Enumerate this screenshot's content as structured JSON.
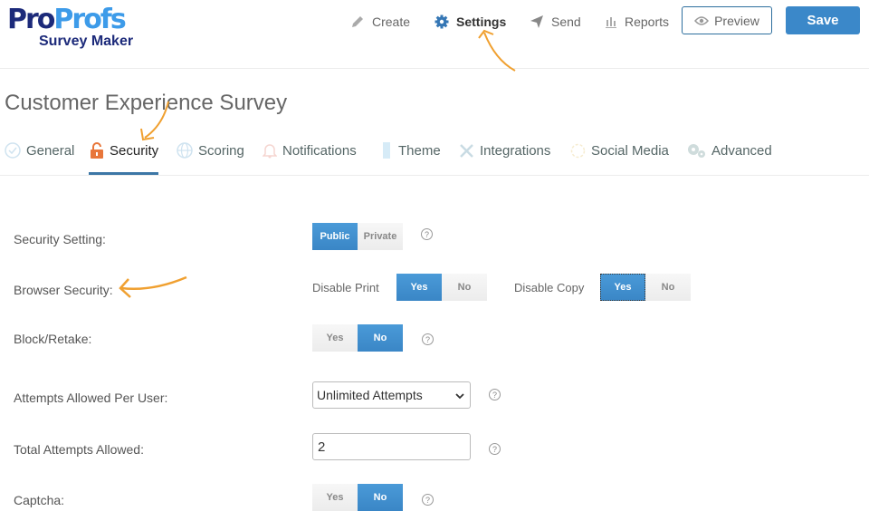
{
  "brand": {
    "logo_part1": "Pro",
    "logo_part2": "Profs",
    "logo_sub": "Survey Maker",
    "dark_color": "#1c2a7a",
    "light_color": "#3d9be9"
  },
  "topnav": {
    "items": [
      {
        "label": "Create",
        "icon": "pencil-icon",
        "active": false
      },
      {
        "label": "Settings",
        "icon": "gear-icon",
        "active": true
      },
      {
        "label": "Send",
        "icon": "paper-plane-icon",
        "active": false
      },
      {
        "label": "Reports",
        "icon": "bar-chart-icon",
        "active": false
      }
    ],
    "preview_label": "Preview",
    "save_label": "Save"
  },
  "page": {
    "title": "Customer Experience Survey"
  },
  "tabs": [
    {
      "label": "General",
      "icon": "check-circle-icon"
    },
    {
      "label": "Security",
      "icon": "lock-icon",
      "active": true
    },
    {
      "label": "Scoring",
      "icon": "globe-icon"
    },
    {
      "label": "Notifications",
      "icon": "bell-icon"
    },
    {
      "label": "Theme",
      "icon": "paintbrush-icon"
    },
    {
      "label": "Integrations",
      "icon": "tools-icon"
    },
    {
      "label": "Social Media",
      "icon": "share-icon"
    },
    {
      "label": "Advanced",
      "icon": "gears-icon"
    }
  ],
  "settings": {
    "security_setting": {
      "label": "Security Setting:",
      "options": [
        "Public",
        "Private"
      ],
      "selected": "Public"
    },
    "browser_security": {
      "label": "Browser Security:",
      "disable_print": {
        "label": "Disable Print",
        "options": [
          "Yes",
          "No"
        ],
        "selected": "Yes"
      },
      "disable_copy": {
        "label": "Disable Copy",
        "options": [
          "Yes",
          "No"
        ],
        "selected": "Yes"
      }
    },
    "block_retake": {
      "label": "Block/Retake:",
      "options": [
        "Yes",
        "No"
      ],
      "selected": "No"
    },
    "attempts_per_user": {
      "label": "Attempts Allowed Per User:",
      "value": "Unlimited Attempts"
    },
    "total_attempts": {
      "label": "Total Attempts Allowed:",
      "value": "2"
    },
    "captcha": {
      "label": "Captcha:",
      "options": [
        "Yes",
        "No"
      ],
      "selected": "No"
    },
    "help_glyph": "?"
  },
  "colors": {
    "accent": "#3b88c9",
    "annotation_arrow": "#f0a030"
  }
}
